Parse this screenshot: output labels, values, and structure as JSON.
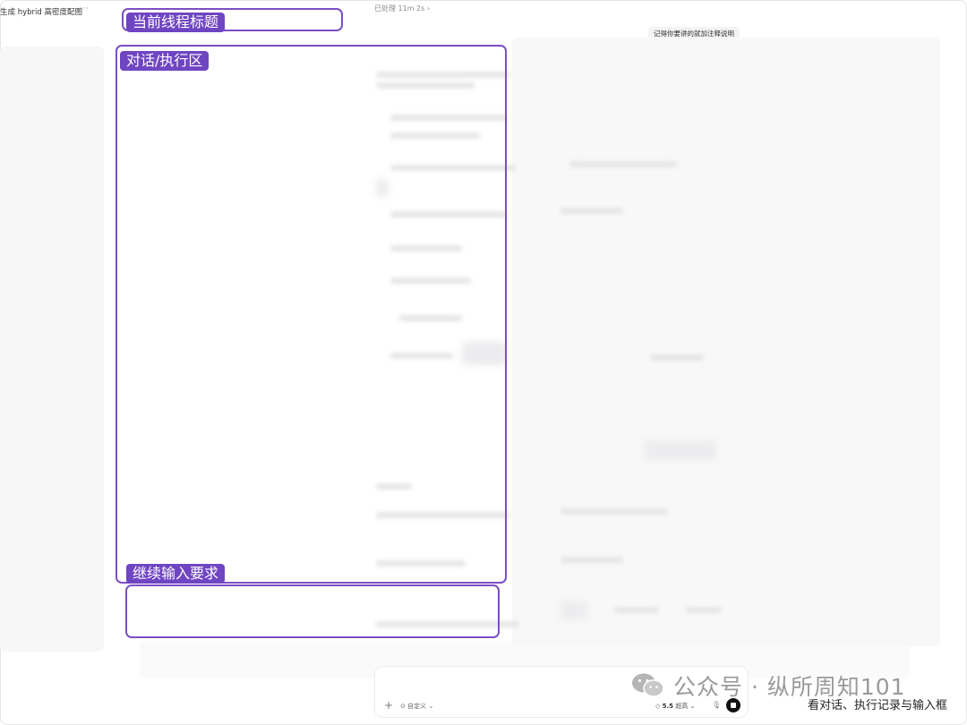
{
  "header": {
    "thread_title": "生成 hybrid 高密度配图",
    "more": "···",
    "processed": "已处理 11m 2s ›"
  },
  "chat": {
    "user_message_chip": "记得你要讲的就加注释说明"
  },
  "composer": {
    "mode_label": "⊙ 自定义 ⌄",
    "model_label_bold": "5.5",
    "model_label_rest": "超高 ⌄",
    "model_icon": "◇",
    "plus_icon": "+",
    "mic_icon": "🎙"
  },
  "annotations": {
    "title_label": "当前线程标题",
    "chat_label": "对话/执行区",
    "input_label": "继续输入要求",
    "accent_color": "#6f45c2"
  },
  "watermark": {
    "text": "公众号 · 纵所周知101"
  },
  "caption": {
    "text": "看对话、执行记录与输入框"
  }
}
